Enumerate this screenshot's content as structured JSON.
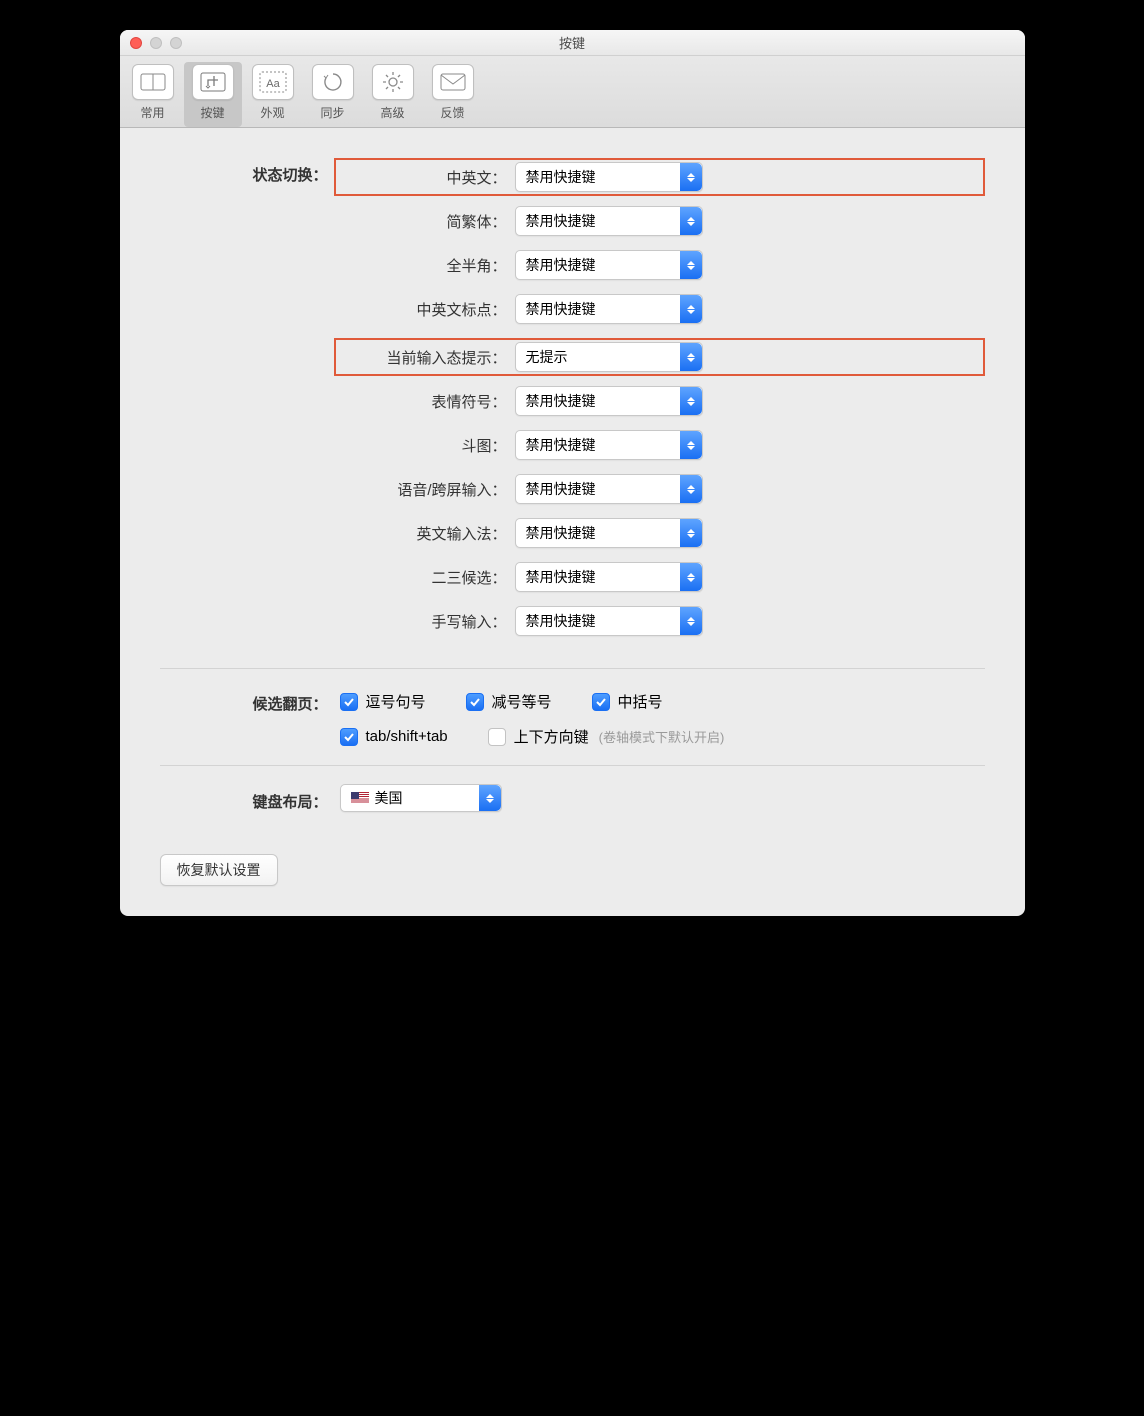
{
  "window": {
    "title": "按键"
  },
  "toolbar": {
    "items": [
      {
        "label": "常用"
      },
      {
        "label": "按键"
      },
      {
        "label": "外观"
      },
      {
        "label": "同步"
      },
      {
        "label": "高级"
      },
      {
        "label": "反馈"
      }
    ],
    "selected_index": 1
  },
  "sections": {
    "state_switch_label": "状态切换：",
    "page_select_label": "候选翻页：",
    "keyboard_layout_label": "键盘布局："
  },
  "rows": [
    {
      "label": "中英文：",
      "value": "禁用快捷键",
      "highlight": true
    },
    {
      "label": "简繁体：",
      "value": "禁用快捷键",
      "highlight": false
    },
    {
      "label": "全半角：",
      "value": "禁用快捷键",
      "highlight": false
    },
    {
      "label": "中英文标点：",
      "value": "禁用快捷键",
      "highlight": false
    },
    {
      "label": "当前输入态提示：",
      "value": "无提示",
      "highlight": true
    },
    {
      "label": "表情符号：",
      "value": "禁用快捷键",
      "highlight": false
    },
    {
      "label": "斗图：",
      "value": "禁用快捷键",
      "highlight": false
    },
    {
      "label": "语音/跨屏输入：",
      "value": "禁用快捷键",
      "highlight": false
    },
    {
      "label": "英文输入法：",
      "value": "禁用快捷键",
      "highlight": false
    },
    {
      "label": "二三候选：",
      "value": "禁用快捷键",
      "highlight": false
    },
    {
      "label": "手写输入：",
      "value": "禁用快捷键",
      "highlight": false
    }
  ],
  "page_checks": {
    "comma_period": {
      "label": "逗号句号",
      "checked": true
    },
    "minus_equal": {
      "label": "减号等号",
      "checked": true
    },
    "brackets": {
      "label": "中括号",
      "checked": true
    },
    "tab": {
      "label": "tab/shift+tab",
      "checked": true
    },
    "arrows": {
      "label": "上下方向键",
      "checked": false,
      "hint": "(卷轴模式下默认开启)"
    }
  },
  "keyboard_layout": {
    "value": "美国"
  },
  "reset_button": "恢复默认设置"
}
